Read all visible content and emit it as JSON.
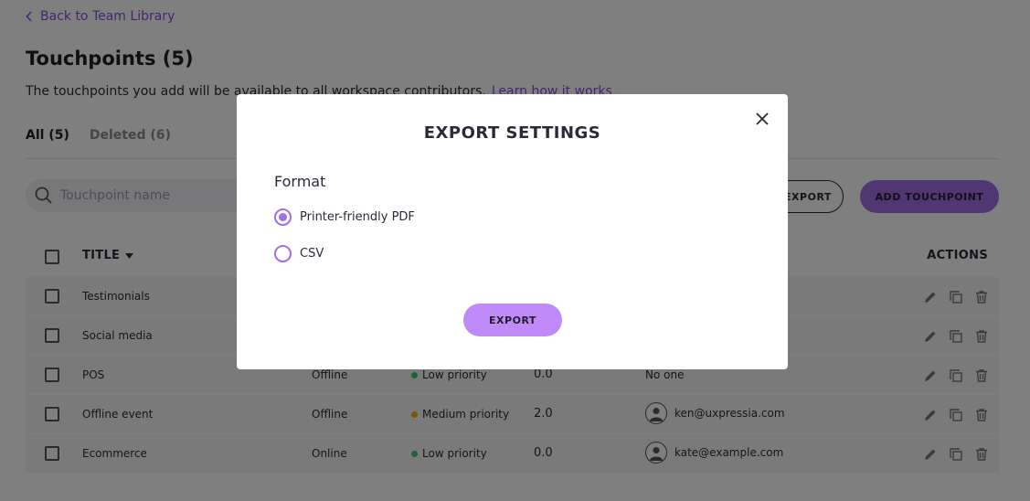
{
  "nav": {
    "back_label": "Back to Team Library"
  },
  "header": {
    "title": "Touchpoints (5)",
    "subtitle": "The touchpoints you add will be available to all workspace contributors.",
    "learn_link": "Learn how it works"
  },
  "tabs": {
    "all": "All (5)",
    "deleted": "Deleted (6)"
  },
  "search": {
    "placeholder": "Touchpoint name"
  },
  "toolbar": {
    "export_label": "EXPORT",
    "add_label": "ADD TOUCHPOINT"
  },
  "table": {
    "col_title": "TITLE",
    "col_actions": "ACTIONS",
    "rows": [
      {
        "title": "Testimonials"
      },
      {
        "title": "Social media"
      },
      {
        "title": "POS",
        "type": "Offline",
        "priority": "Low priority",
        "priority_color": "#3ec46d",
        "score": "0.0",
        "owner": "No one"
      },
      {
        "title": "Offline event",
        "type": "Offline",
        "priority": "Medium priority",
        "priority_color": "#f0b400",
        "score": "2.0",
        "owner": "ken@uxpressia.com"
      },
      {
        "title": "Ecommerce",
        "type": "Online",
        "priority": "Low priority",
        "priority_color": "#3ec46d",
        "score": "0.0",
        "owner": "kate@example.com"
      }
    ]
  },
  "modal": {
    "title": "EXPORT SETTINGS",
    "format_label": "Format",
    "options": [
      {
        "label": "Printer-friendly PDF",
        "selected": true
      },
      {
        "label": "CSV",
        "selected": false
      }
    ],
    "export_button": "EXPORT"
  },
  "colors": {
    "accent": "#a06ee8",
    "modal_button": "#c08af8",
    "link": "#8a4be0"
  }
}
